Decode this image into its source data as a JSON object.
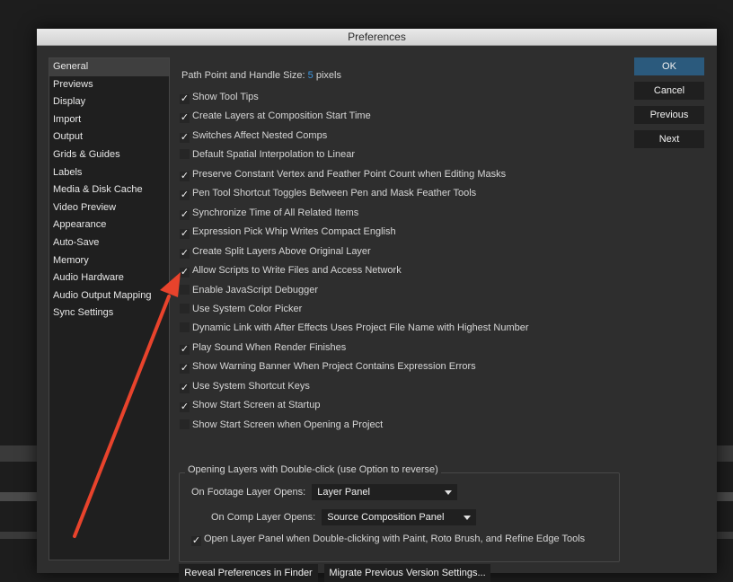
{
  "window": {
    "title": "Preferences"
  },
  "sidebar": {
    "items": [
      {
        "label": "General",
        "selected": true
      },
      {
        "label": "Previews"
      },
      {
        "label": "Display"
      },
      {
        "label": "Import"
      },
      {
        "label": "Output"
      },
      {
        "label": "Grids & Guides"
      },
      {
        "label": "Labels"
      },
      {
        "label": "Media & Disk Cache"
      },
      {
        "label": "Video Preview"
      },
      {
        "label": "Appearance"
      },
      {
        "label": "Auto-Save"
      },
      {
        "label": "Memory"
      },
      {
        "label": "Audio Hardware"
      },
      {
        "label": "Audio Output Mapping"
      },
      {
        "label": "Sync Settings"
      }
    ]
  },
  "general": {
    "path_label": "Path Point and Handle Size:",
    "path_value": "5",
    "path_unit": "pixels",
    "options": [
      {
        "label": "Show Tool Tips",
        "checked": true
      },
      {
        "label": "Create Layers at Composition Start Time",
        "checked": true
      },
      {
        "label": "Switches Affect Nested Comps",
        "checked": true
      },
      {
        "label": "Default Spatial Interpolation to Linear",
        "checked": false
      },
      {
        "label": "Preserve Constant Vertex and Feather Point Count when Editing Masks",
        "checked": true
      },
      {
        "label": "Pen Tool Shortcut Toggles Between Pen and Mask Feather Tools",
        "checked": true
      },
      {
        "label": "Synchronize Time of All Related Items",
        "checked": true
      },
      {
        "label": "Expression Pick Whip Writes Compact English",
        "checked": true
      },
      {
        "label": "Create Split Layers Above Original Layer",
        "checked": true
      },
      {
        "label": "Allow Scripts to Write Files and Access Network",
        "checked": true
      },
      {
        "label": "Enable JavaScript Debugger",
        "checked": false
      },
      {
        "label": "Use System Color Picker",
        "checked": false
      },
      {
        "label": "Dynamic Link with After Effects Uses Project File Name with Highest Number",
        "checked": false
      },
      {
        "label": "Play Sound When Render Finishes",
        "checked": true
      },
      {
        "label": "Show Warning Banner When Project Contains Expression Errors",
        "checked": true
      },
      {
        "label": "Use System Shortcut Keys",
        "checked": true
      },
      {
        "label": "Show Start Screen at Startup",
        "checked": true
      },
      {
        "label": "Show Start Screen when Opening a Project",
        "checked": false
      }
    ],
    "double_click_group": {
      "title": "Opening Layers with Double-click (use Option to reverse)",
      "footage_label": "On Footage Layer Opens:",
      "footage_value": "Layer Panel",
      "comp_label": "On Comp Layer Opens:",
      "comp_value": "Source Composition Panel",
      "paint_option": {
        "label": "Open Layer Panel when Double-clicking with Paint, Roto Brush, and Refine Edge Tools",
        "checked": true
      }
    },
    "reveal_button": "Reveal Preferences in Finder",
    "migrate_button": "Migrate Previous Version Settings..."
  },
  "buttons": {
    "ok": "OK",
    "cancel": "Cancel",
    "previous": "Previous",
    "next": "Next"
  },
  "colors": {
    "accent": "#3c95de",
    "primary_button": "#2b5a7d",
    "annotation_arrow": "#e8432c"
  },
  "check_glyph": "✓"
}
